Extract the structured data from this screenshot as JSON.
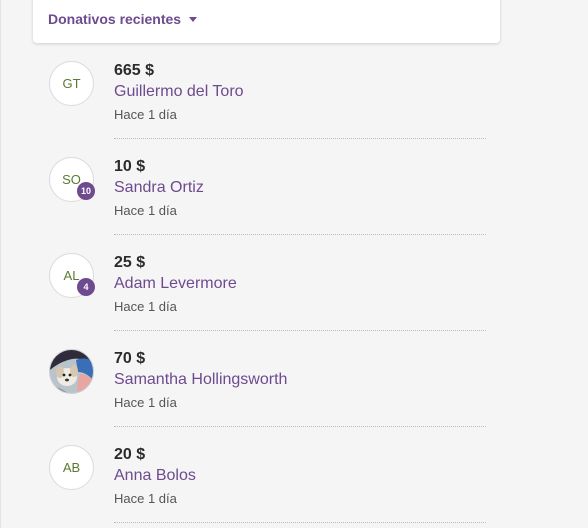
{
  "header": {
    "title": "Donativos recientes",
    "dropdown_icon": "caret-down-icon"
  },
  "donations": [
    {
      "initials": "GT",
      "amount": "665 $",
      "name": "Guillermo del Toro",
      "time": "Hace 1 día",
      "badge": ""
    },
    {
      "initials": "SO",
      "amount": "10 $",
      "name": "Sandra Ortiz",
      "time": "Hace 1 día",
      "badge": "10"
    },
    {
      "initials": "AL",
      "amount": "25 $",
      "name": "Adam Levermore",
      "time": "Hace 1 día",
      "badge": "4"
    },
    {
      "initials": "",
      "amount": "70 $",
      "name": "Samantha Hollingsworth",
      "time": "Hace 1 día",
      "badge": ""
    },
    {
      "initials": "AB",
      "amount": "20 $",
      "name": "Anna Bolos",
      "time": "Hace 1 día",
      "badge": ""
    }
  ],
  "colors": {
    "accent": "#6e4a8e",
    "initials": "#5a7a30",
    "amount": "#2b2b2b",
    "muted": "#555555"
  }
}
